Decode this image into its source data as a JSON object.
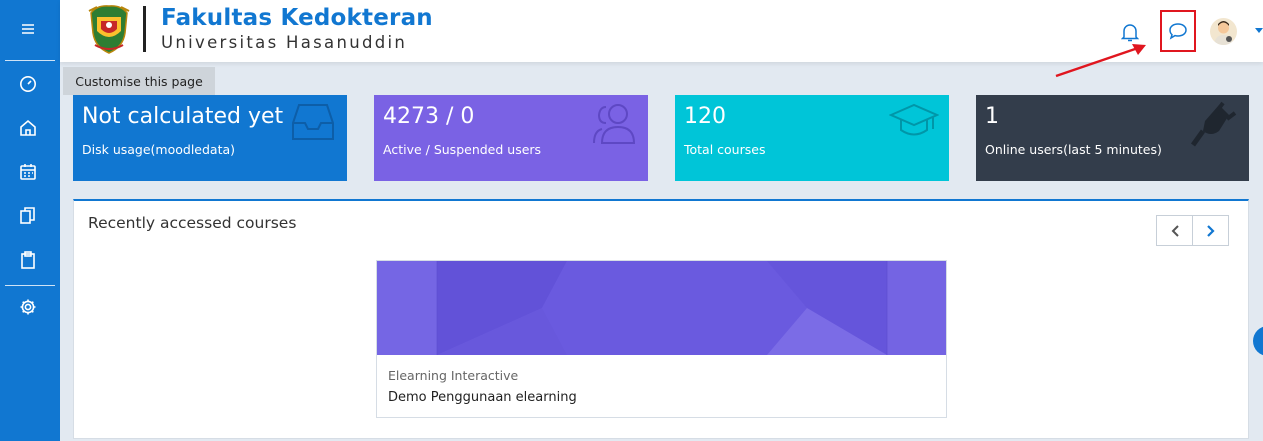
{
  "header": {
    "brand_title": "Fakultas Kedokteran",
    "brand_subtitle": "Universitas Hasanuddin",
    "icons": [
      "bell-icon",
      "chat-icon",
      "avatar",
      "caret-down-icon"
    ]
  },
  "rail": {
    "icons": [
      "hamburger-icon",
      "dashboard-icon",
      "home-icon",
      "calendar-icon",
      "files-icon",
      "clipboard-icon",
      "gear-icon"
    ]
  },
  "customise_label": "Customise this page",
  "stats": [
    {
      "value": "Not calculated yet",
      "label": "Disk usage(moodledata)",
      "color": "#1177d1",
      "icon": "inbox-icon"
    },
    {
      "value": "4273 / 0",
      "label": "Active / Suspended users",
      "color": "#7a62e4",
      "icon": "users-icon"
    },
    {
      "value": "120",
      "label": "Total courses",
      "color": "#00c5d8",
      "icon": "graduation-cap-icon"
    },
    {
      "value": "1",
      "label": "Online users(last 5 minutes)",
      "color": "#333d4b",
      "icon": "plug-icon"
    }
  ],
  "recent": {
    "title": "Recently accessed courses",
    "course": {
      "category": "Elearning Interactive",
      "name": "Demo Penggunaan elearning"
    }
  },
  "colors": {
    "accent": "#1177d1",
    "highlight_box": "#e0161f"
  }
}
